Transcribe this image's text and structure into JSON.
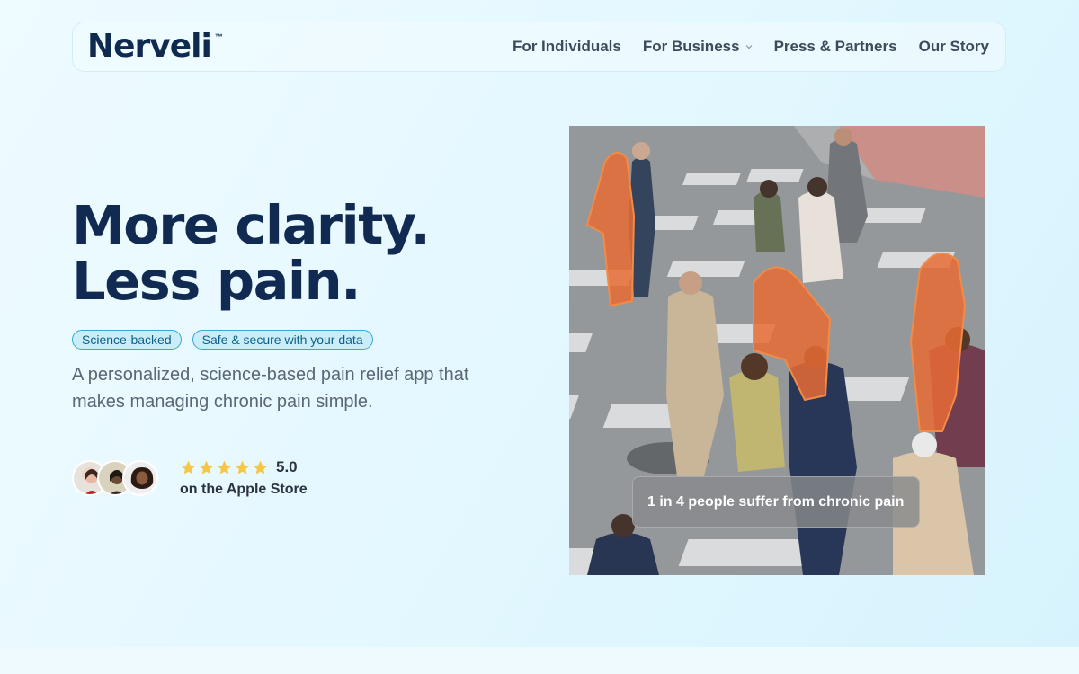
{
  "brand": {
    "name": "Nerveli",
    "tm": "™"
  },
  "nav": {
    "items": [
      {
        "label": "For Individuals"
      },
      {
        "label": "For Business",
        "has_dropdown": true
      },
      {
        "label": "Press & Partners"
      },
      {
        "label": "Our Story"
      }
    ]
  },
  "hero": {
    "title_line1": "More clarity.",
    "title_line2": "Less pain.",
    "badges": [
      "Science-backed",
      "Safe & secure with your data"
    ],
    "subtitle": "A personalized, science-based pain relief app that makes managing chronic pain simple.",
    "rating": {
      "stars": 5,
      "score": "5.0",
      "source": "on the Apple Store",
      "star_color": "#f7c744"
    },
    "image": {
      "caption": "1 in 4 people suffer from chronic pain",
      "highlight_color": "#e8642a"
    }
  },
  "colors": {
    "brand_navy": "#102a52",
    "badge_border": "#37a9cf",
    "badge_bg": "#c9eefa"
  }
}
